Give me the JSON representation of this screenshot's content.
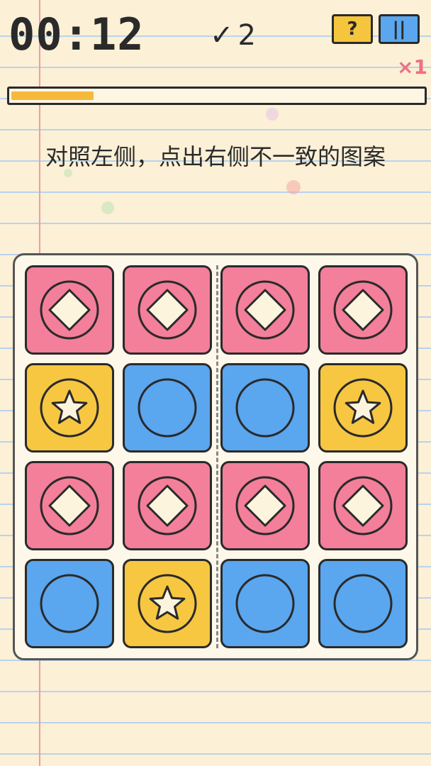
{
  "hud": {
    "timer": "00:12",
    "check_icon": "✓",
    "score": "2",
    "help_label": "?",
    "pause_label": "||",
    "multiplier": "×1",
    "progress_fraction": 0.2
  },
  "instruction": "对照左侧，点出右侧不一致的图案",
  "colors": {
    "pink": "#f37f9a",
    "yellow": "#f7c742",
    "blue": "#5aa6ef"
  },
  "grid": [
    [
      {
        "color": "pink",
        "icon": "diamond-in-circle"
      },
      {
        "color": "pink",
        "icon": "diamond-in-circle"
      },
      {
        "color": "pink",
        "icon": "diamond-in-circle"
      },
      {
        "color": "pink",
        "icon": "diamond-in-circle"
      }
    ],
    [
      {
        "color": "yellow",
        "icon": "star-in-circle"
      },
      {
        "color": "blue",
        "icon": "circle"
      },
      {
        "color": "blue",
        "icon": "circle"
      },
      {
        "color": "yellow",
        "icon": "star-in-circle"
      }
    ],
    [
      {
        "color": "pink",
        "icon": "diamond-in-circle"
      },
      {
        "color": "pink",
        "icon": "diamond-in-circle"
      },
      {
        "color": "pink",
        "icon": "diamond-in-circle"
      },
      {
        "color": "pink",
        "icon": "diamond-in-circle"
      }
    ],
    [
      {
        "color": "blue",
        "icon": "circle"
      },
      {
        "color": "yellow",
        "icon": "star-in-circle"
      },
      {
        "color": "blue",
        "icon": "circle"
      },
      {
        "color": "blue",
        "icon": "circle"
      }
    ]
  ]
}
